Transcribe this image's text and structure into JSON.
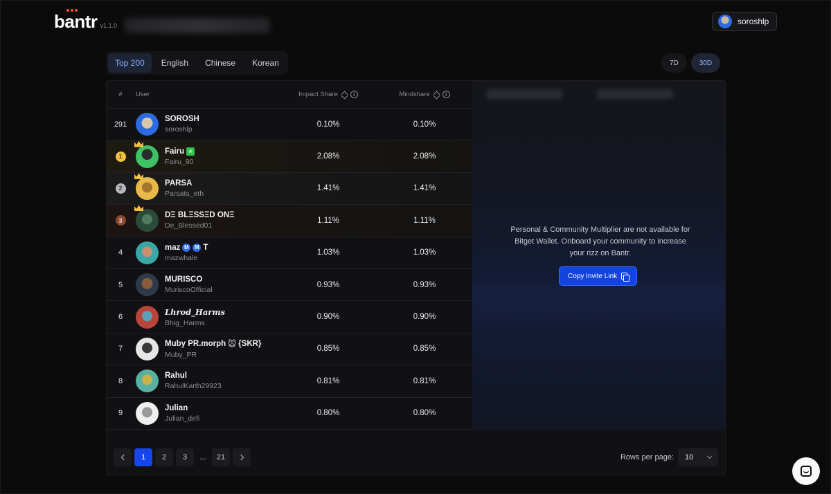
{
  "header": {
    "logo_text": "bantr",
    "version": "v1.1.0",
    "user_name": "soroshlp"
  },
  "lang_tabs": [
    "Top 200",
    "English",
    "Chinese",
    "Korean"
  ],
  "range_tabs": [
    "7D",
    "30D"
  ],
  "table": {
    "col_num": "#",
    "col_user": "User",
    "col_impact": "Impact Share",
    "col_mind": "Mindshare",
    "rows": [
      {
        "rank": "291",
        "name": "SOROSH",
        "handle": "soroshlp",
        "impact": "0.10%",
        "mind": "0.10%"
      },
      {
        "rank": "1",
        "name": "Fairu",
        "handle": "Fairu_90",
        "impact": "2.08%",
        "mind": "2.08%"
      },
      {
        "rank": "2",
        "name": "PARSA",
        "handle": "Parsats_eth",
        "impact": "1.41%",
        "mind": "1.41%"
      },
      {
        "rank": "3",
        "name": "DΞ BLΞSSΞD ONΞ",
        "handle": "De_Blessed01",
        "impact": "1.11%",
        "mind": "1.11%"
      },
      {
        "rank": "4",
        "name": "maz",
        "name_suffix": "T",
        "handle": "mazwhale",
        "impact": "1.03%",
        "mind": "1.03%"
      },
      {
        "rank": "5",
        "name": "MURISCO",
        "handle": "MuriscoOfficial",
        "impact": "0.93%",
        "mind": "0.93%"
      },
      {
        "rank": "6",
        "name": "𝑳𝒉𝒓𝒐𝒅_𝑯𝒂𝒓𝒎𝒔",
        "handle": "Bhig_Harms",
        "impact": "0.90%",
        "mind": "0.90%"
      },
      {
        "rank": "7",
        "name": "Muby PR.morph",
        "name_suffix": " {SKR}",
        "handle": "Muby_PR",
        "impact": "0.85%",
        "mind": "0.85%"
      },
      {
        "rank": "8",
        "name": "Rahul",
        "handle": "RahulKarth29923",
        "impact": "0.81%",
        "mind": "0.81%"
      },
      {
        "rank": "9",
        "name": "Julian",
        "handle": "Julian_defi",
        "impact": "0.80%",
        "mind": "0.80%"
      }
    ]
  },
  "right_panel": {
    "message": "Personal & Community Multiplier are not available for Bitget Wallet. Onboard your community to increase your rizz on Bantr.",
    "button": "Copy Invite Link"
  },
  "pagination": {
    "pages": [
      "1",
      "2",
      "3",
      "...",
      "21"
    ],
    "rows_label": "Rows per page:",
    "rows_value": "10"
  },
  "colors": {
    "accent": "#1646ea",
    "gold": "#f0c244",
    "silver": "#b9b9bd",
    "bronze": "#8a4a30"
  }
}
